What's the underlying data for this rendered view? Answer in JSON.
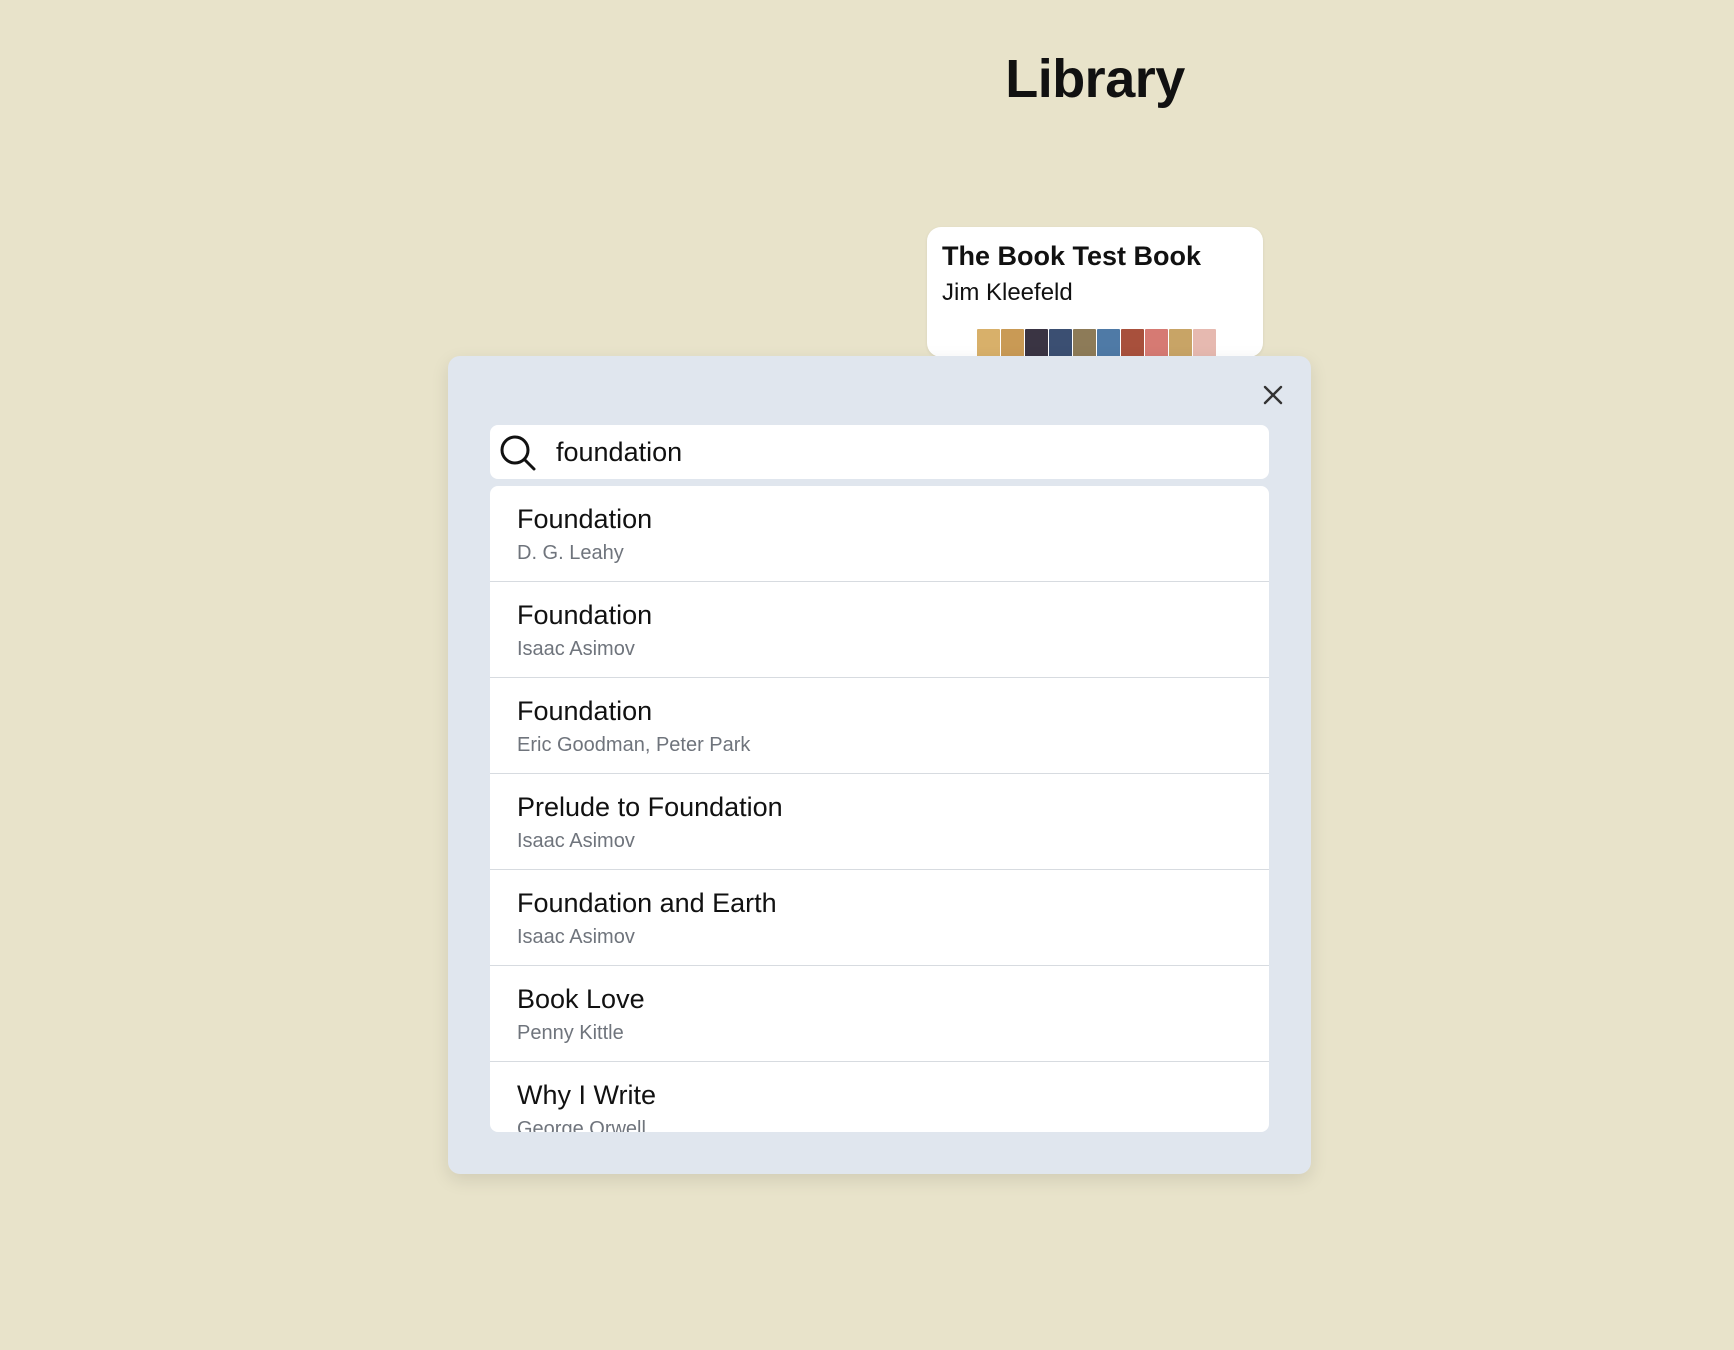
{
  "header": {
    "title": "Library"
  },
  "book_card": {
    "title": "The Book Test Book",
    "author": "Jim Kleefeld",
    "cover_colors": [
      "#d8b06a",
      "#c99a55",
      "#3a3443",
      "#3b4f72",
      "#8d7b58",
      "#4f7aa6",
      "#a8503c",
      "#d67a73",
      "#c8a466",
      "#e6b9b0"
    ]
  },
  "search": {
    "value": "foundation",
    "placeholder": ""
  },
  "results": [
    {
      "title": "Foundation",
      "author": "D. G. Leahy"
    },
    {
      "title": "Foundation",
      "author": "Isaac Asimov"
    },
    {
      "title": "Foundation",
      "author": "Eric Goodman, Peter Park"
    },
    {
      "title": "Prelude to Foundation",
      "author": "Isaac Asimov"
    },
    {
      "title": "Foundation and Earth",
      "author": "Isaac Asimov"
    },
    {
      "title": "Book Love",
      "author": "Penny Kittle"
    },
    {
      "title": "Why I Write",
      "author": "George Orwell"
    }
  ],
  "colors": {
    "background": "#e8e3ca",
    "modal": "#e0e6ee",
    "author_text": "#6f747c"
  }
}
